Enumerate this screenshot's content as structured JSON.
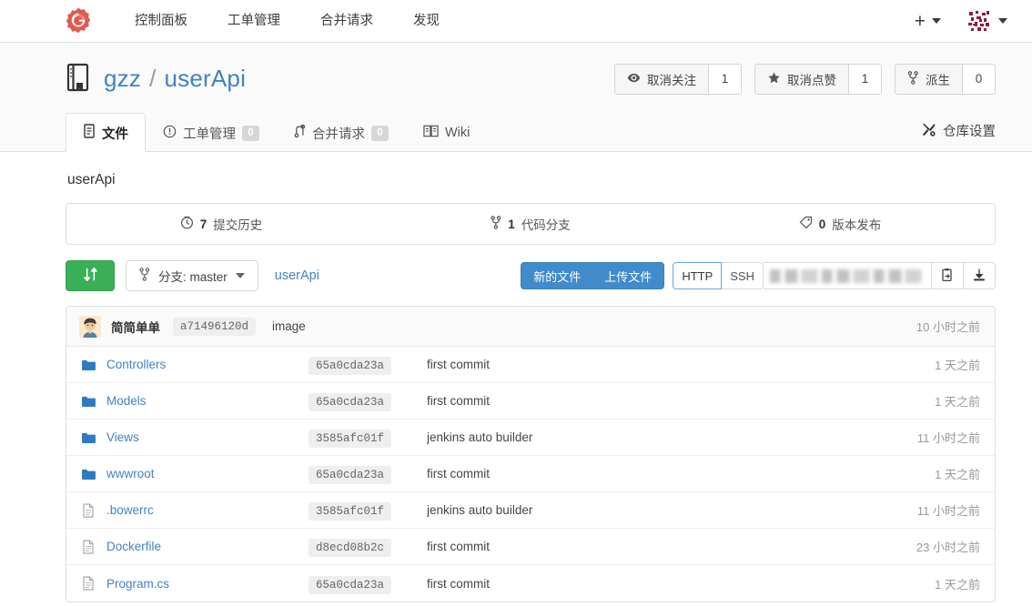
{
  "navbar": {
    "logo_icon": "gitea-gear-logo",
    "links": [
      {
        "label": "控制面板",
        "name": "nav-dashboard"
      },
      {
        "label": "工单管理",
        "name": "nav-issues"
      },
      {
        "label": "合并请求",
        "name": "nav-pulls"
      },
      {
        "label": "发现",
        "name": "nav-explore"
      }
    ],
    "create_icon": "plus-icon",
    "create_caret": "chevron-down-icon",
    "avatar_icon": "user-avatar",
    "avatar_caret": "chevron-down-icon"
  },
  "repo": {
    "icon": "repo-book-icon",
    "owner": "gzz",
    "separator": "/",
    "name": "userApi",
    "actions": [
      {
        "name": "watch",
        "icon": "eye-icon",
        "label": "取消关注",
        "count": "1"
      },
      {
        "name": "star",
        "icon": "star-icon",
        "label": "取消点赞",
        "count": "1"
      },
      {
        "name": "fork",
        "icon": "fork-icon",
        "label": "派生",
        "count": "0"
      }
    ]
  },
  "tabs": {
    "items": [
      {
        "name": "tab-code",
        "icon": "file-icon",
        "label": "文件",
        "badge": null,
        "active": true
      },
      {
        "name": "tab-issues",
        "icon": "issue-icon",
        "label": "工单管理",
        "badge": "0",
        "active": false
      },
      {
        "name": "tab-pulls",
        "icon": "pull-request-icon",
        "label": "合并请求",
        "badge": "0",
        "active": false
      },
      {
        "name": "tab-wiki",
        "icon": "book-icon",
        "label": "Wiki",
        "badge": null,
        "active": false
      }
    ],
    "settings": {
      "icon": "tools-icon",
      "label": "仓库设置"
    }
  },
  "main": {
    "title": "userApi",
    "stats": [
      {
        "name": "commits",
        "icon": "history-icon",
        "count": "7",
        "label": "提交历史"
      },
      {
        "name": "branches",
        "icon": "branch-icon",
        "count": "1",
        "label": "代码分支"
      },
      {
        "name": "releases",
        "icon": "tag-icon",
        "count": "0",
        "label": "版本发布"
      }
    ],
    "toolbar": {
      "compare_icon": "compare-sync-icon",
      "branch_icon": "branch-icon",
      "branch_label": "分支: master",
      "branch_caret": "chevron-down-icon",
      "breadcrumb": "userApi",
      "new_file_label": "新的文件",
      "upload_file_label": "上传文件",
      "protocols": [
        {
          "label": "HTTP",
          "active": true
        },
        {
          "label": "SSH",
          "active": false
        }
      ],
      "clone_url_value": "",
      "clone_url_placeholder": "",
      "copy_icon": "clipboard-copy-icon",
      "download_icon": "download-icon"
    },
    "latest_commit": {
      "avatar": "commit-author-avatar",
      "author": "简简单单",
      "sha": "a71496120d",
      "message": "image",
      "time": "10 小时之前"
    },
    "files": [
      {
        "type": "folder",
        "icon": "folder-icon",
        "name": "Controllers",
        "sha": "65a0cda23a",
        "message": "first commit",
        "time": "1 天之前"
      },
      {
        "type": "folder",
        "icon": "folder-icon",
        "name": "Models",
        "sha": "65a0cda23a",
        "message": "first commit",
        "time": "1 天之前"
      },
      {
        "type": "folder",
        "icon": "folder-icon",
        "name": "Views",
        "sha": "3585afc01f",
        "message": "jenkins auto builder",
        "time": "11 小时之前"
      },
      {
        "type": "folder",
        "icon": "folder-icon",
        "name": "wwwroot",
        "sha": "65a0cda23a",
        "message": "first commit",
        "time": "1 天之前"
      },
      {
        "type": "file",
        "icon": "file-icon",
        "name": ".bowerrc",
        "sha": "3585afc01f",
        "message": "jenkins auto builder",
        "time": "11 小时之前"
      },
      {
        "type": "file",
        "icon": "file-icon",
        "name": "Dockerfile",
        "sha": "d8ecd08b2c",
        "message": "first commit",
        "time": "23 小时之前"
      },
      {
        "type": "file",
        "icon": "file-icon",
        "name": "Program.cs",
        "sha": "65a0cda23a",
        "message": "first commit",
        "time": "1 天之前"
      }
    ]
  },
  "colors": {
    "link": "#4183c4",
    "green": "#3aaf57",
    "blue": "#428bca",
    "folder": "#2d7bc4",
    "logo_red": "#e05a4e",
    "muted": "#999999"
  }
}
